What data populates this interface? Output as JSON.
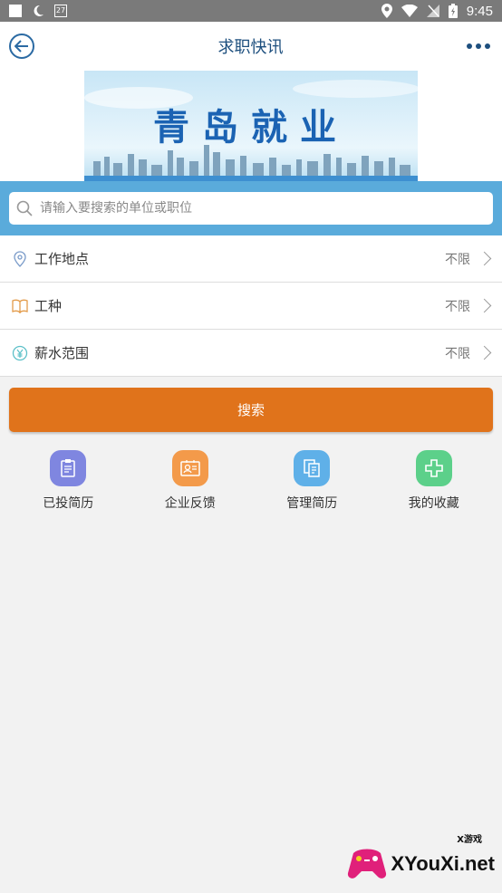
{
  "status_bar": {
    "calendar_day": "27",
    "time": "9:45"
  },
  "header": {
    "title": "求职快讯"
  },
  "banner": {
    "text": "青岛就业"
  },
  "search": {
    "placeholder": "请输入要搜索的单位或职位",
    "value": ""
  },
  "filters": [
    {
      "label": "工作地点",
      "value": "不限",
      "icon": "location-pin-icon",
      "color": "#7a9bc9"
    },
    {
      "label": "工种",
      "value": "不限",
      "icon": "book-icon",
      "color": "#e39b4a"
    },
    {
      "label": "薪水范围",
      "value": "不限",
      "icon": "yuan-icon",
      "color": "#5cc0c8"
    }
  ],
  "search_button": {
    "label": "搜索",
    "color": "#e0731b"
  },
  "quick_actions": [
    {
      "label": "已投简历",
      "icon": "clipboard-icon",
      "color": "#7f86e0"
    },
    {
      "label": "企业反馈",
      "icon": "id-card-icon",
      "color": "#f39a4a"
    },
    {
      "label": "管理简历",
      "icon": "documents-icon",
      "color": "#5fb0e8"
    },
    {
      "label": "我的收藏",
      "icon": "plus-cross-icon",
      "color": "#5cd08a"
    }
  ],
  "watermark": {
    "badge": "X游戏",
    "text": "XYouXi.net"
  },
  "colors": {
    "accent_blue": "#5aabdb",
    "title_blue": "#1d4f7e",
    "background": "#f2f2f2"
  }
}
